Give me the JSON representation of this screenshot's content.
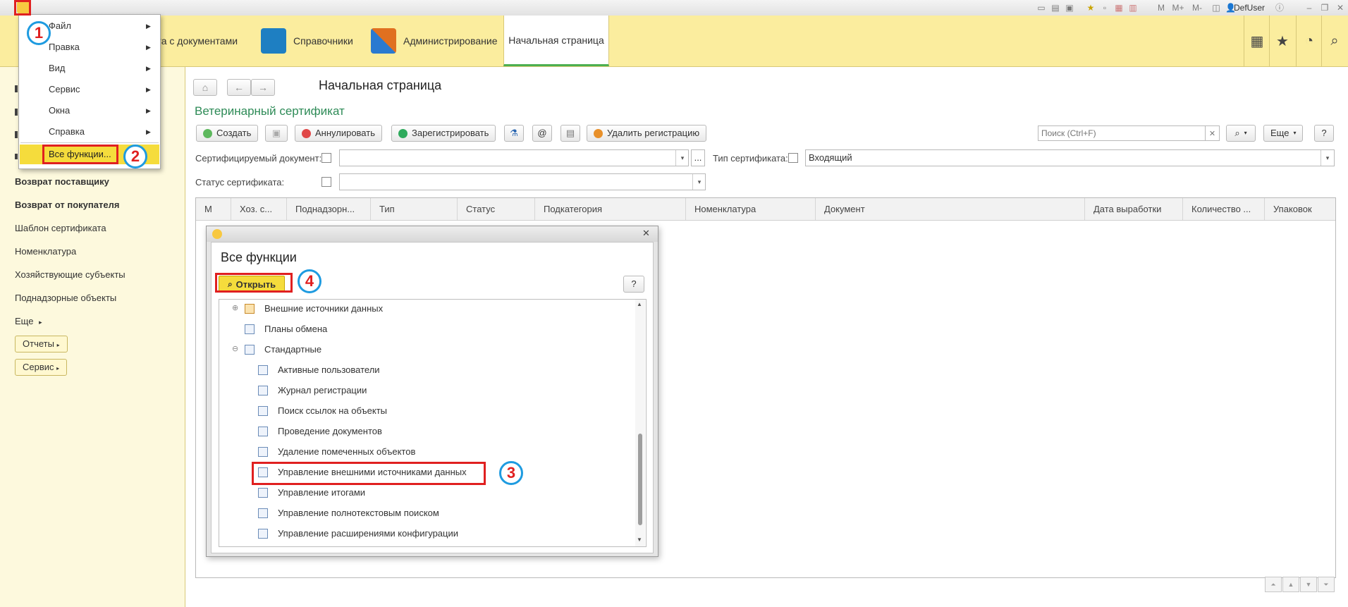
{
  "titlebar": {
    "user": "DefUser",
    "m_label": "M",
    "mplus_label": "M+",
    "mminus_label": "M-"
  },
  "sections": {
    "documents_partial": "ота с документами",
    "references": "Справочники",
    "administration": "Администрирование",
    "home": "Начальная страница"
  },
  "left_panel": {
    "items": [
      {
        "label": "Возврат поставщику",
        "bold": true
      },
      {
        "label": "Возврат от покупателя",
        "bold": true
      },
      {
        "label": "Шаблон сертификата",
        "bold": false
      },
      {
        "label": "Номенклатура",
        "bold": false
      },
      {
        "label": "Хозяйствующие субъекты",
        "bold": false
      },
      {
        "label": "Поднадзорные объекты",
        "bold": false
      }
    ],
    "more": "Еще",
    "reports": "Отчеты",
    "service": "Сервис"
  },
  "page_title": "Начальная страница",
  "form_title": "Ветеринарный сертификат",
  "toolbar": {
    "create": "Создать",
    "cancel": "Аннулировать",
    "register": "Зарегистрировать",
    "at": "@",
    "delete_registration": "Удалить регистрацию",
    "search_placeholder": "Поиск (Ctrl+F)",
    "more": "Еще",
    "help": "?"
  },
  "filters": {
    "cert_doc_label": "Сертифицируемый документ:",
    "cert_doc_value": "",
    "cert_type_label": "Тип сертификата:",
    "cert_type_value": "Входящий",
    "cert_status_label": "Статус сертификата:",
    "cert_status_value": ""
  },
  "grid": {
    "columns": [
      "М",
      "Хоз. с...",
      "Поднадзорн...",
      "Тип",
      "Статус",
      "Подкатегория",
      "Номенклатура",
      "Документ",
      "Дата выработки",
      "Количество ...",
      "Упаковок"
    ]
  },
  "main_menu": {
    "items": [
      {
        "label": "Файл",
        "accel": "Ф"
      },
      {
        "label": "Правка",
        "accel": "П"
      },
      {
        "label": "Вид",
        "accel": "В"
      },
      {
        "label": "Сервис",
        "accel": "С"
      },
      {
        "label": "Окна",
        "accel": "О"
      },
      {
        "label": "Справка",
        "accel": "С"
      }
    ],
    "all_functions": "Все функции..."
  },
  "dialog": {
    "title": "Все функции",
    "open_button": "Открыть",
    "help": "?",
    "tree": [
      {
        "label": "Внешние источники данных",
        "level": 0,
        "expander": "⊕"
      },
      {
        "label": "Планы обмена",
        "level": 0,
        "expander": ""
      },
      {
        "label": "Стандартные",
        "level": 0,
        "expander": "⊖"
      },
      {
        "label": "Активные пользователи",
        "level": 1
      },
      {
        "label": "Журнал регистрации",
        "level": 1
      },
      {
        "label": "Поиск ссылок на объекты",
        "level": 1
      },
      {
        "label": "Проведение документов",
        "level": 1
      },
      {
        "label": "Удаление помеченных объектов",
        "level": 1
      },
      {
        "label": "Управление внешними источниками данных",
        "level": 1
      },
      {
        "label": "Управление итогами",
        "level": 1
      },
      {
        "label": "Управление полнотекстовым поиском",
        "level": 1
      },
      {
        "label": "Управление расширениями конфигурации",
        "level": 1
      }
    ]
  },
  "annotations": [
    "1",
    "2",
    "3",
    "4"
  ],
  "colors": {
    "section_bar": "#fbed9e",
    "highlight": "#f5dc3c",
    "annotation_box": "#e02020",
    "annotation_circle": "#1e9be0",
    "form_title": "#2e8b57"
  }
}
